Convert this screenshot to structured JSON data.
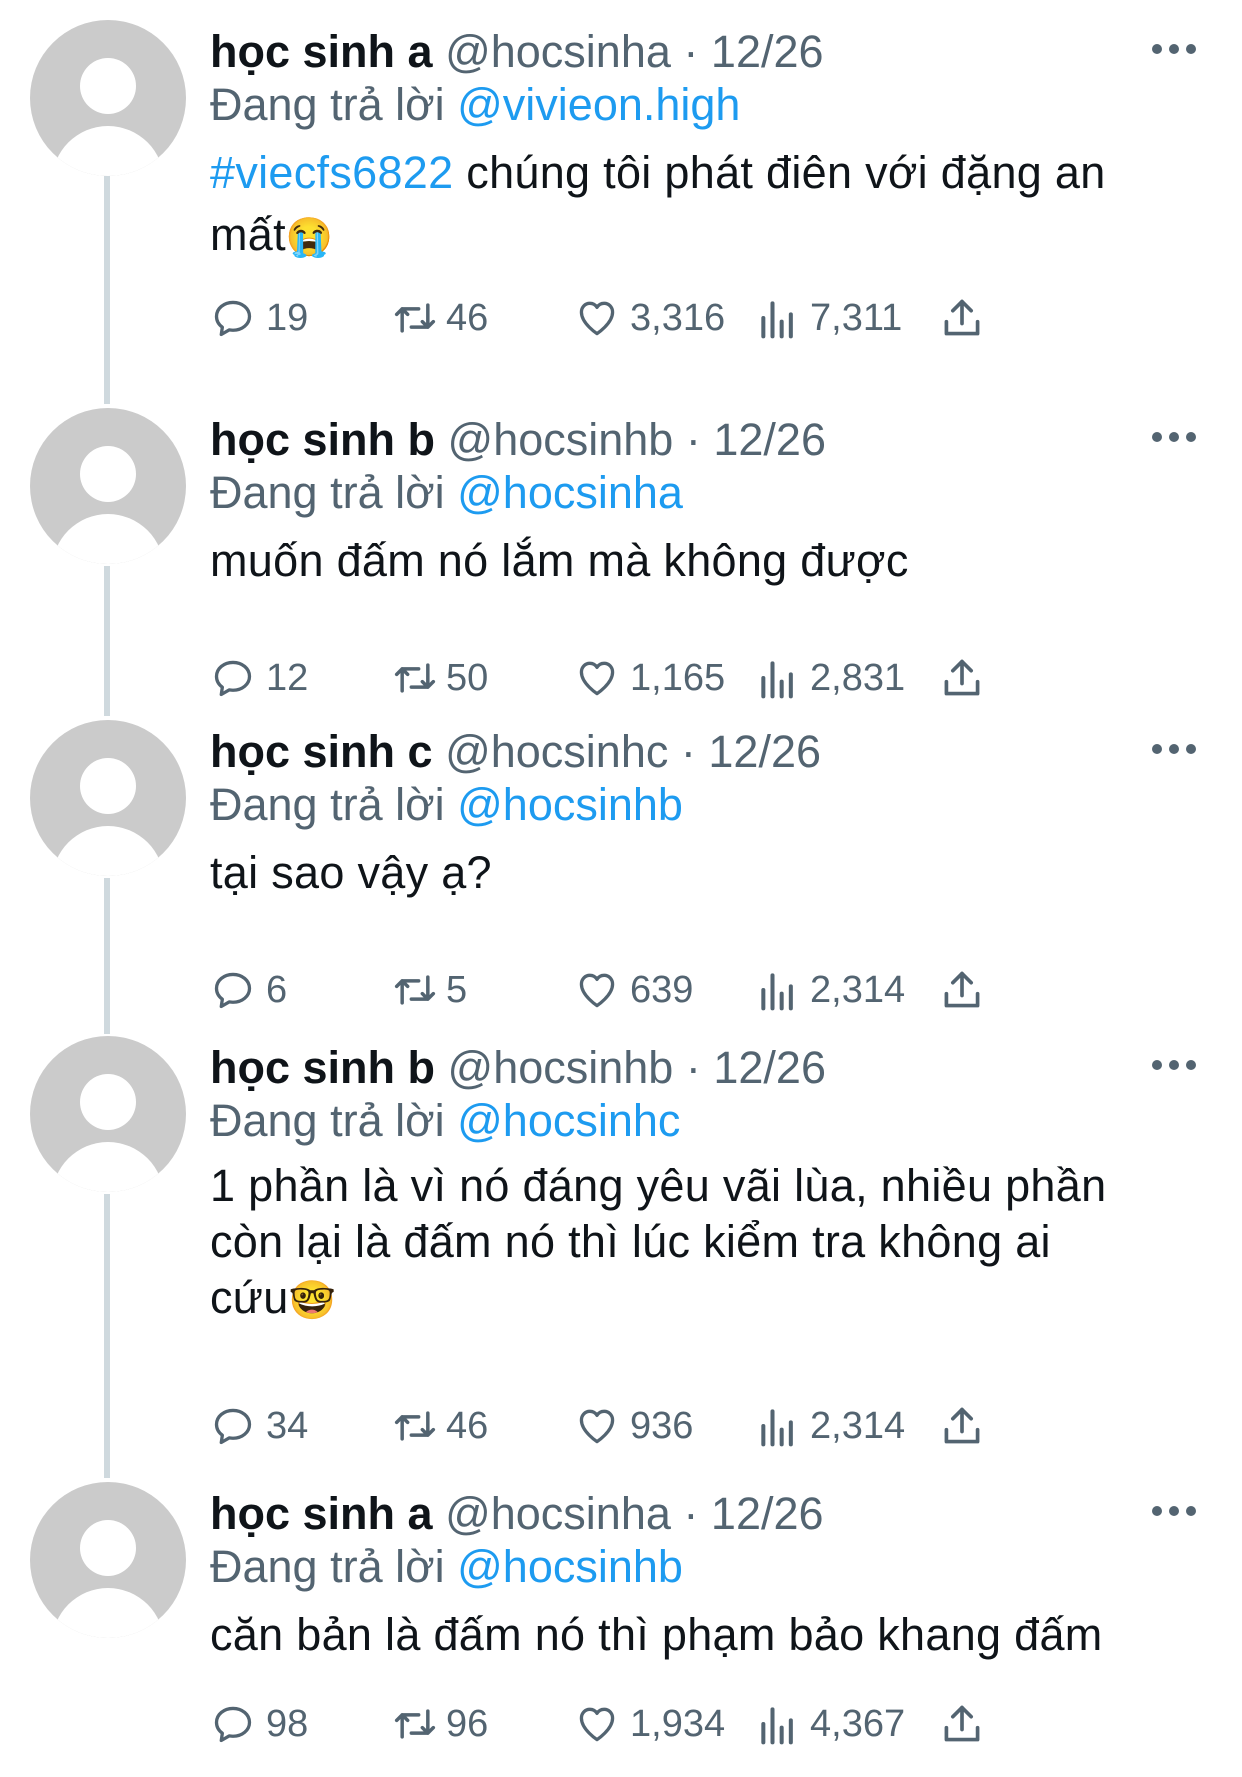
{
  "reply_prefix": "Đang trả lời",
  "tweets": [
    {
      "name": "học sinh a",
      "handle": "@hocsinha",
      "date": "12/26",
      "reply_to": "@vivieon.high",
      "hashtag": "#viecfs6822",
      "text": " chúng tôi phát điên với đặng an\nmất",
      "emoji": "😭",
      "replies": "19",
      "retweets": "46",
      "likes": "3,316",
      "views": "7,311"
    },
    {
      "name": "học sinh b",
      "handle": "@hocsinhb",
      "date": "12/26",
      "reply_to": "@hocsinha",
      "text": "muốn đấm nó lắm mà không được",
      "replies": "12",
      "retweets": "50",
      "likes": "1,165",
      "views": "2,831"
    },
    {
      "name": "học sinh c",
      "handle": "@hocsinhc",
      "date": "12/26",
      "reply_to": "@hocsinhb",
      "text": "tại sao vậy ạ?",
      "replies": "6",
      "retweets": "5",
      "likes": "639",
      "views": "2,314"
    },
    {
      "name": "học sinh b",
      "handle": "@hocsinhb",
      "date": "12/26",
      "reply_to": "@hocsinhc",
      "text": "1 phần là vì nó đáng yêu vãi lùa, nhiều phần\ncòn lại là đấm nó thì lúc kiểm tra không ai\ncứu",
      "emoji": "🤓",
      "replies": "34",
      "retweets": "46",
      "likes": "936",
      "views": "2,314"
    },
    {
      "name": "học sinh a",
      "handle": "@hocsinha",
      "date": "12/26",
      "reply_to": "@hocsinhb",
      "text": "căn bản là đấm nó thì phạm bảo khang đấm",
      "replies": "98",
      "retweets": "96",
      "likes": "1,934",
      "views": "4,367"
    }
  ],
  "icons": {
    "reply": "reply-icon",
    "retweet": "retweet-icon",
    "like": "like-icon",
    "views": "views-icon",
    "share": "share-icon",
    "more": "more-icon"
  },
  "colors": {
    "text": "#0f1419",
    "secondary": "#536471",
    "link": "#1d9bf0",
    "avatar": "#cbcbcb"
  }
}
